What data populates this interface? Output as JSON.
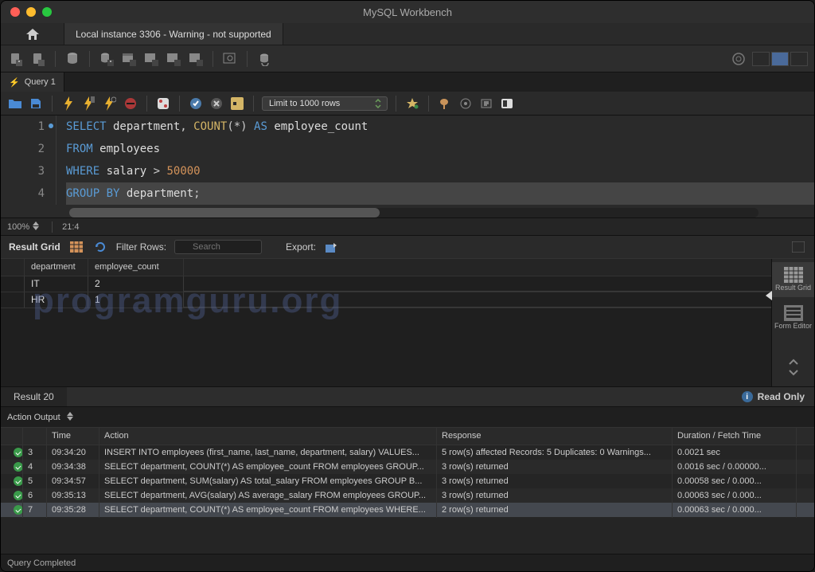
{
  "app_title": "MySQL Workbench",
  "connection_tab": "Local instance 3306 - Warning - not supported",
  "query_tab_label": "Query 1",
  "limit_select": "Limit to 1000 rows",
  "editor": {
    "lines": [
      "1",
      "2",
      "3",
      "4"
    ],
    "code": {
      "l1_kw1": "SELECT",
      "l1_id1": " department",
      "l1_pn": ", ",
      "l1_fn": "COUNT",
      "l1_op": "(*)",
      "l1_kw2": " AS",
      "l1_id2": " employee_count",
      "l2_kw": "FROM",
      "l2_id": " employees",
      "l3_kw": "WHERE",
      "l3_id": " salary ",
      "l3_op": ">",
      "l3_sp": " ",
      "l3_num": "50000",
      "l4_kw": "GROUP BY",
      "l4_id": " department",
      "l4_pn": ";"
    },
    "zoom": "100%",
    "cursor": "21:4"
  },
  "result_toolbar": {
    "label": "Result Grid",
    "filter_label": "Filter Rows:",
    "search_placeholder": "Search",
    "export_label": "Export:"
  },
  "result": {
    "columns": [
      "department",
      "employee_count"
    ],
    "rows": [
      {
        "department": "IT",
        "employee_count": "2"
      },
      {
        "department": "HR",
        "employee_count": "1"
      }
    ],
    "side_tabs": {
      "grid": "Result Grid",
      "form": "Form Editor"
    },
    "footer_tab": "Result 20",
    "readonly_label": "Read Only"
  },
  "output": {
    "selector": "Action Output",
    "headers": {
      "time": "Time",
      "action": "Action",
      "response": "Response",
      "duration": "Duration / Fetch Time"
    },
    "rows": [
      {
        "n": "3",
        "time": "09:34:20",
        "action": "INSERT INTO employees (first_name, last_name, department, salary) VALUES...",
        "response": "5 row(s) affected Records: 5  Duplicates: 0  Warnings...",
        "duration": "0.0021 sec"
      },
      {
        "n": "4",
        "time": "09:34:38",
        "action": "SELECT department, COUNT(*) AS employee_count FROM employees GROUP...",
        "response": "3 row(s) returned",
        "duration": "0.0016 sec / 0.00000..."
      },
      {
        "n": "5",
        "time": "09:34:57",
        "action": "SELECT department, SUM(salary) AS total_salary FROM employees GROUP B...",
        "response": "3 row(s) returned",
        "duration": "0.00058 sec / 0.000..."
      },
      {
        "n": "6",
        "time": "09:35:13",
        "action": "SELECT department, AVG(salary) AS average_salary FROM employees GROUP...",
        "response": "3 row(s) returned",
        "duration": "0.00063 sec / 0.000..."
      },
      {
        "n": "7",
        "time": "09:35:28",
        "action": "SELECT department, COUNT(*) AS employee_count FROM employees WHERE...",
        "response": "2 row(s) returned",
        "duration": "0.00063 sec / 0.000..."
      }
    ]
  },
  "statusbar": "Query Completed",
  "watermark": "programguru.org"
}
